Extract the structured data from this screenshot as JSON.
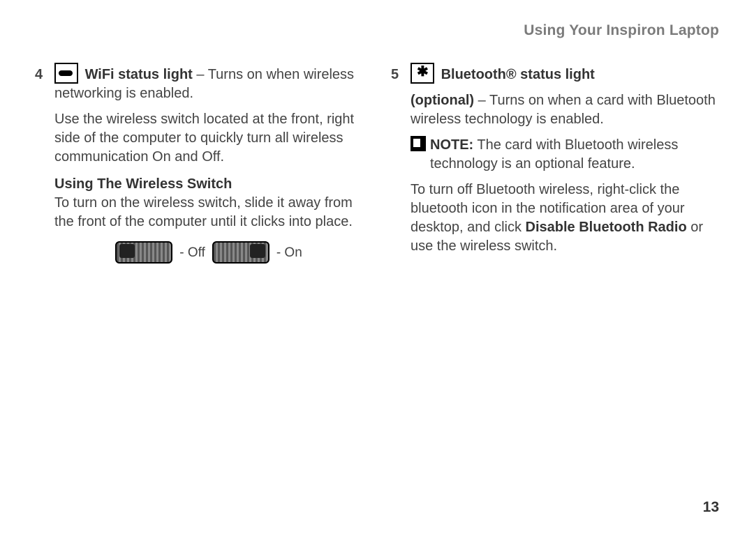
{
  "header": "Using Your Inspiron Laptop",
  "page_number": "13",
  "left": {
    "num": "4",
    "title": "WiFi status light",
    "title_tail": " – Turns on when wireless networking is enabled.",
    "para2": "Use the wireless switch located at the front, right side of the computer to quickly turn all wireless communication On and Off.",
    "subhead": "Using The Wireless Switch",
    "para3": "To turn on the wireless switch, slide it away from the front of the computer until it clicks into place.",
    "off_label": " - Off",
    "on_label": " - On"
  },
  "right": {
    "num": "5",
    "title": "Bluetooth® status light",
    "opt_bold": "(optional)",
    "opt_tail": " – Turns on when a card with Bluetooth wireless technology is enabled.",
    "note_bold": "NOTE:",
    "note_text": " The card with Bluetooth wireless technology is an optional feature.",
    "para2a": "To turn off Bluetooth wireless, right-click the bluetooth icon in the notification area of your desktop, and click ",
    "para2b": "Disable Bluetooth Radio",
    "para2c": " or use the wireless switch."
  }
}
